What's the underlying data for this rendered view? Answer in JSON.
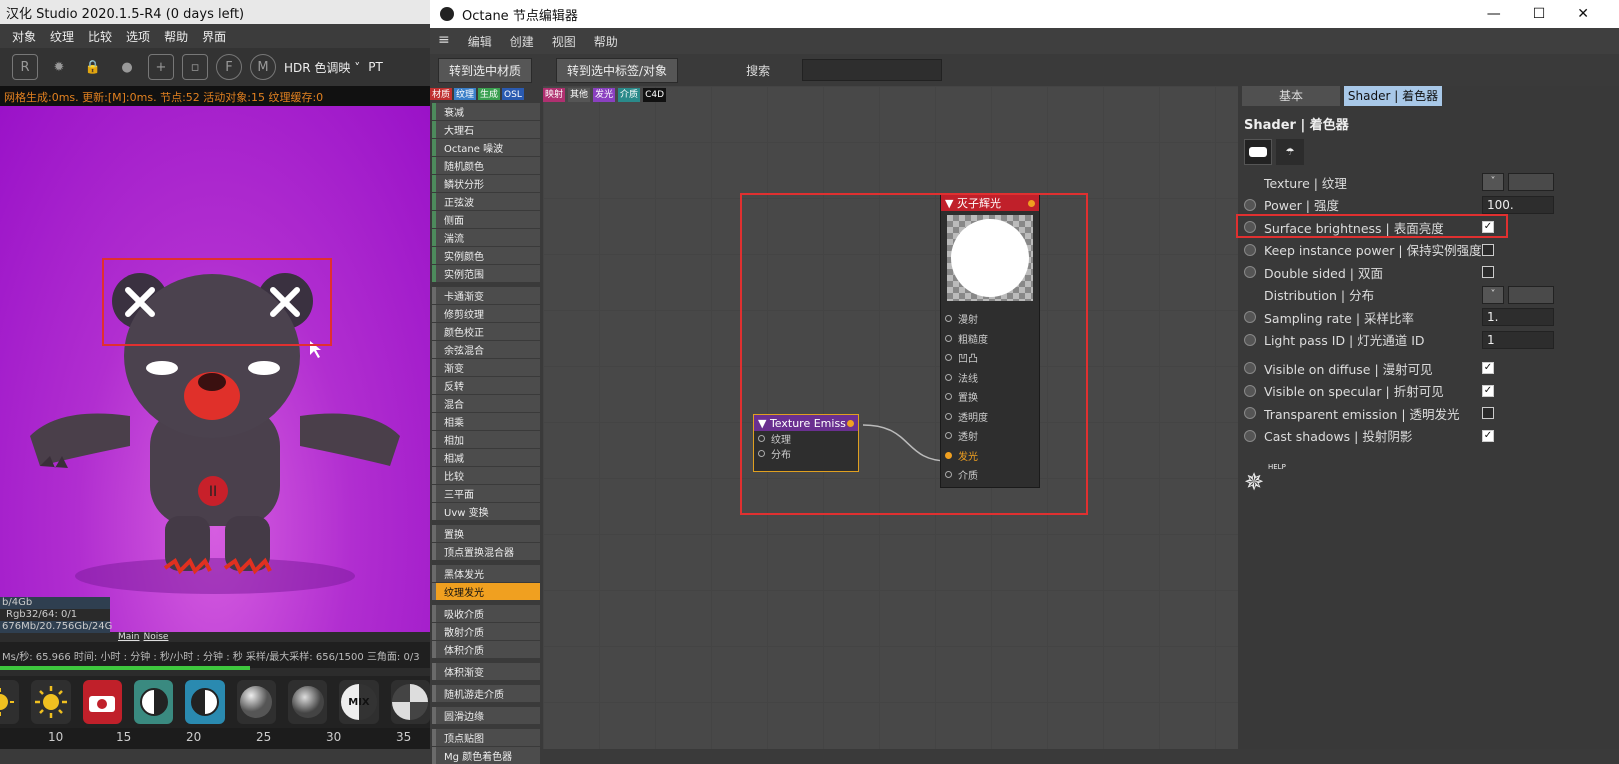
{
  "live_viewer": {
    "title": "汉化 Studio 2020.1.5-R4 (0 days left)",
    "menu": [
      "对象",
      "纹理",
      "比较",
      "选项",
      "帮助",
      "界面"
    ],
    "hdr_select": "HDR 色调映 ˅",
    "pt_label": "PT",
    "status": "网格生成:0ms. 更新:[M]:0ms. 节点:52 活动对象:15 纹理缓存:0",
    "info_lines": [
      "b/4Gb",
      "Rgb32/64: 0/1",
      "676Mb/20.756Gb/24G"
    ],
    "info_tabs": [
      "Main",
      "Noise"
    ],
    "bottom_status": "Ms/秒: 65.966   时间: 小时 : 分钟 : 秒/小时 : 分钟 : 秒   采样/最大采样: 656/1500  三角面: 0/3",
    "mix_label": "MIX",
    "ruler": [
      "10",
      "15",
      "20",
      "25",
      "30",
      "35"
    ]
  },
  "node_editor": {
    "title": "Octane 节点编辑器",
    "window_controls": [
      "—",
      "☐",
      "✕"
    ],
    "menu": [
      "编辑",
      "创建",
      "视图",
      "帮助"
    ],
    "toolbar": {
      "goto_material": "转到选中材质",
      "goto_tag": "转到选中标签/对象",
      "search_label": "搜索",
      "search_value": ""
    },
    "palette_tabs": [
      {
        "label": "材质",
        "color": "#c03030"
      },
      {
        "label": "纹理",
        "color": "#3a7fc8"
      },
      {
        "label": "生成",
        "color": "#3aa050"
      },
      {
        "label": "OSL",
        "color": "#2a5ab0"
      }
    ],
    "canvas_tabs": [
      {
        "label": "映射",
        "color": "#b03070"
      },
      {
        "label": "其他",
        "color": "#555555"
      },
      {
        "label": "发光",
        "color": "#8a40c0"
      },
      {
        "label": "介质",
        "color": "#2a8a8a"
      },
      {
        "label": "C4D",
        "color": "#111111"
      }
    ],
    "palette_items": [
      {
        "label": "衰减",
        "kind": "tex"
      },
      {
        "label": "大理石",
        "kind": "tex"
      },
      {
        "label": "Octane 噪波",
        "kind": "tex"
      },
      {
        "label": "随机颜色",
        "kind": "tex"
      },
      {
        "label": "鳞状分形",
        "kind": "tex"
      },
      {
        "label": "正弦波",
        "kind": "tex"
      },
      {
        "label": "侧面",
        "kind": "tex"
      },
      {
        "label": "湍流",
        "kind": "tex"
      },
      {
        "label": "实例颜色",
        "kind": "tex"
      },
      {
        "label": "实例范围",
        "kind": "tex"
      },
      {
        "label": "卡通渐变",
        "kind": "gap"
      },
      {
        "label": "修剪纹理",
        "kind": "other"
      },
      {
        "label": "颜色校正",
        "kind": "other"
      },
      {
        "label": "余弦混合",
        "kind": "other"
      },
      {
        "label": "渐变",
        "kind": "other"
      },
      {
        "label": "反转",
        "kind": "other"
      },
      {
        "label": "混合",
        "kind": "other"
      },
      {
        "label": "相乘",
        "kind": "other"
      },
      {
        "label": "相加",
        "kind": "other"
      },
      {
        "label": "相减",
        "kind": "other"
      },
      {
        "label": "比较",
        "kind": "other"
      },
      {
        "label": "三平面",
        "kind": "other"
      },
      {
        "label": "Uvw 变换",
        "kind": "other"
      },
      {
        "label": "置换",
        "kind": "gap"
      },
      {
        "label": "顶点置换混合器",
        "kind": "other"
      },
      {
        "label": "黑体发光",
        "kind": "gap"
      },
      {
        "label": "纹理发光",
        "kind": "sel"
      },
      {
        "label": "吸收介质",
        "kind": "gap"
      },
      {
        "label": "散射介质",
        "kind": "other"
      },
      {
        "label": "体积介质",
        "kind": "other"
      },
      {
        "label": "体积渐变",
        "kind": "gap"
      },
      {
        "label": "随机游走介质",
        "kind": "gap"
      },
      {
        "label": "圆滑边缘",
        "kind": "gap"
      },
      {
        "label": "顶点贴图",
        "kind": "gap"
      },
      {
        "label": "Mg 颜色着色器",
        "kind": "other"
      }
    ],
    "node_main": {
      "title": "▼ 灭子辉光",
      "ports": [
        "漫射",
        "粗糙度",
        "凹凸",
        "法线",
        "置换",
        "透明度",
        "透射",
        "发光",
        "介质"
      ],
      "active_port": "发光"
    },
    "node_tex": {
      "title": "▼ Texture Emiss",
      "ports": [
        "纹理",
        "分布"
      ]
    }
  },
  "properties": {
    "tabs": [
      "基本",
      "Shader | 着色器"
    ],
    "heading": "Shader | 着色器",
    "rows": [
      {
        "label": "Texture | 纹理",
        "kind": "link"
      },
      {
        "label": "Power | 强度",
        "kind": "num",
        "value": "100."
      },
      {
        "label": "Surface brightness | 表面亮度",
        "kind": "check",
        "checked": true
      },
      {
        "label": "Keep instance power | 保持实例强度",
        "kind": "check",
        "checked": false
      },
      {
        "label": "Double sided | 双面",
        "kind": "check",
        "checked": false
      },
      {
        "label": "Distribution | 分布",
        "kind": "link"
      },
      {
        "label": "Sampling rate | 采样比率",
        "kind": "num",
        "value": "1."
      },
      {
        "label": "Light pass ID | 灯光通道 ID",
        "kind": "num",
        "value": "1"
      },
      {
        "label": "Visible on diffuse | 漫射可见",
        "kind": "check",
        "checked": true
      },
      {
        "label": "Visible on specular | 折射可见",
        "kind": "check",
        "checked": true
      },
      {
        "label": "Transparent emission | 透明发光",
        "kind": "check",
        "checked": false
      },
      {
        "label": "Cast shadows | 投射阴影",
        "kind": "check",
        "checked": true
      }
    ],
    "help_label": "HELP"
  }
}
